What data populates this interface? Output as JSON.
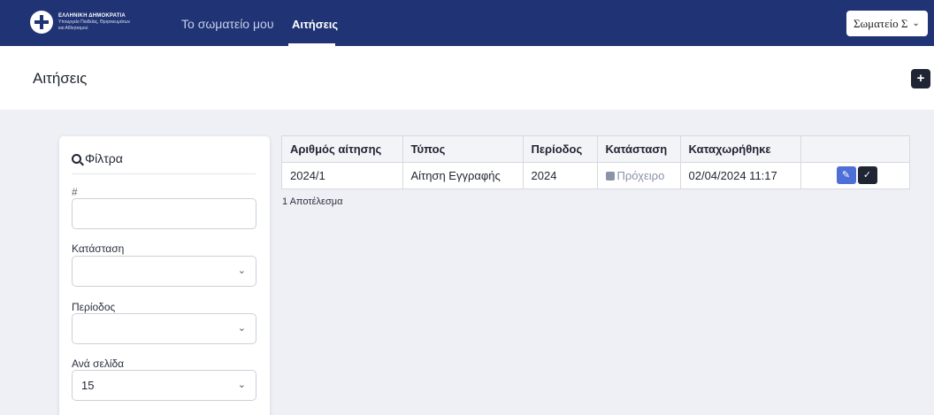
{
  "nav": {
    "logo_line1": "ΕΛΛΗΝΙΚΗ ΔΗΜΟΚΡΑΤΙΑ",
    "logo_line2": "Υπουργείο Παιδείας, Θρησκευμάτων",
    "logo_line3": "και Αθλητισμού",
    "links": [
      "Το σωματείο μου",
      "Αιτήσεις"
    ],
    "active_link": "Αιτήσεις",
    "user_button": "Σωματείο Σ"
  },
  "page": {
    "title": "Αιτήσεις",
    "add_button": "+"
  },
  "filters": {
    "title": "Φίλτρα",
    "hash_label": "#",
    "hash_value": "",
    "status_label": "Κατάσταση",
    "status_value": "",
    "period_label": "Περίοδος",
    "period_value": "",
    "per_page_label": "Ανά σελίδα",
    "per_page_value": "15"
  },
  "table": {
    "columns": [
      "Αριθμός αίτησης",
      "Τύπος",
      "Περίοδος",
      "Κατάσταση",
      "Καταχωρήθηκε",
      ""
    ],
    "rows": [
      {
        "number": "2024/1",
        "type": "Αίτηση Εγγραφής",
        "period": "2024",
        "status": "Πρόχειρο",
        "registered": "02/04/2024 11:17"
      }
    ],
    "results_text": "1 Αποτέλεσμα"
  },
  "colors": {
    "nav_bg": "#1f3375",
    "edit_button": "#4e6fd8",
    "dark_button": "#1f2533",
    "draft_status": "#8b93a8"
  },
  "icons": {
    "filter": "search-icon",
    "chevron": "chevron-down-icon",
    "draft": "draft-status-icon",
    "edit": "edit-icon",
    "submit": "check-icon"
  }
}
